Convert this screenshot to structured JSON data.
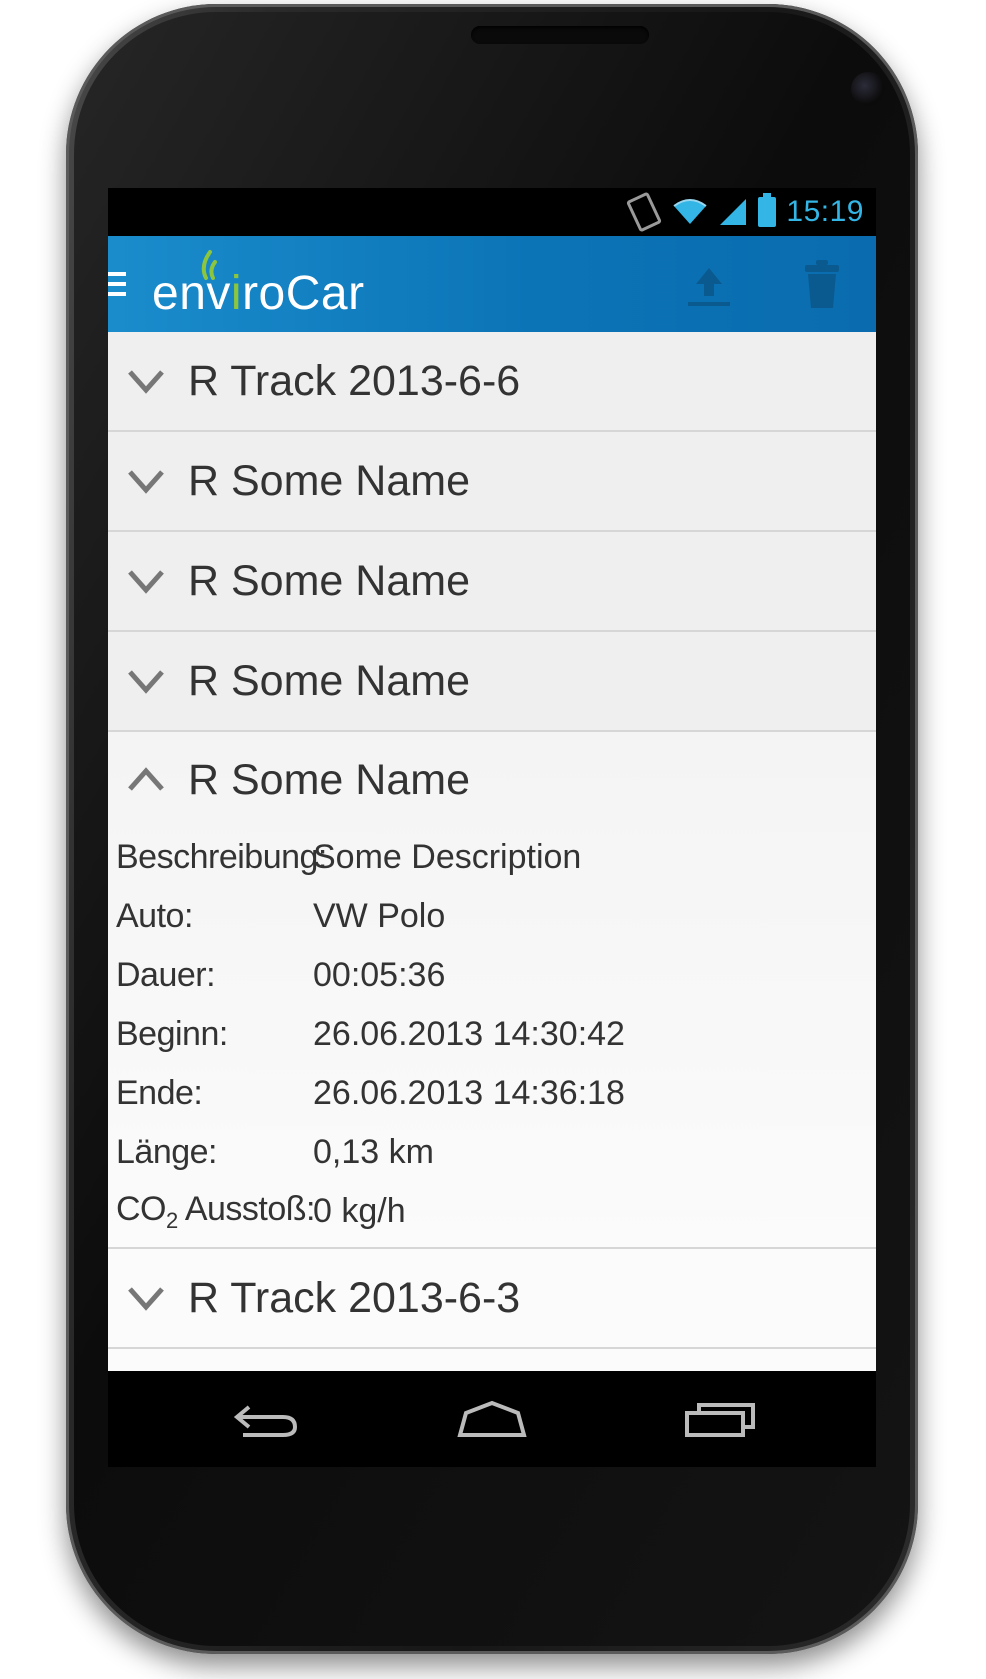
{
  "status_bar": {
    "time": "15:19",
    "icons": [
      "vibrate-icon",
      "wifi-icon",
      "signal-icon",
      "battery-icon"
    ]
  },
  "action_bar": {
    "app_name_prefix": "env",
    "app_name_i": "i",
    "app_name_suffix": "roCar",
    "actions": [
      "upload-icon",
      "trash-icon"
    ],
    "color": "#0b74b7",
    "logo_accent": "#8cc63e"
  },
  "tracks": [
    {
      "title": "R Track 2013-6-6"
    },
    {
      "title": "R Some Name"
    },
    {
      "title": "R Some Name"
    },
    {
      "title": "R Some Name"
    }
  ],
  "expanded_track": {
    "title": "R Some Name",
    "details": [
      {
        "label": "Beschreibung:",
        "value": "Some Description"
      },
      {
        "label": "Auto:",
        "value": "VW Polo"
      },
      {
        "label": "Dauer:",
        "value": "00:05:36"
      },
      {
        "label": "Beginn:",
        "value": "26.06.2013 14:30:42"
      },
      {
        "label": "Ende:",
        "value": "26.06.2013 14:36:18"
      },
      {
        "label": "Länge:",
        "value": "0,13 km"
      }
    ],
    "co2": {
      "label_prefix": "CO",
      "label_sub": "2",
      "label_suffix": " Ausstoß:",
      "value": "0 kg/h"
    }
  },
  "tracks_after": [
    {
      "title": "R Track 2013-6-3"
    }
  ],
  "nav_bar": {
    "buttons": [
      "back-icon",
      "home-icon",
      "recent-apps-icon"
    ]
  }
}
